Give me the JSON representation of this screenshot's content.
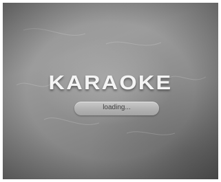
{
  "splash": {
    "logo_text": "KARAOKE",
    "loading_label": "loading..."
  },
  "colors": {
    "background": "#8f8f8f",
    "logo": "#f4f4f4",
    "loading_pill": "#b8b8b8",
    "loading_text": "#404040"
  }
}
